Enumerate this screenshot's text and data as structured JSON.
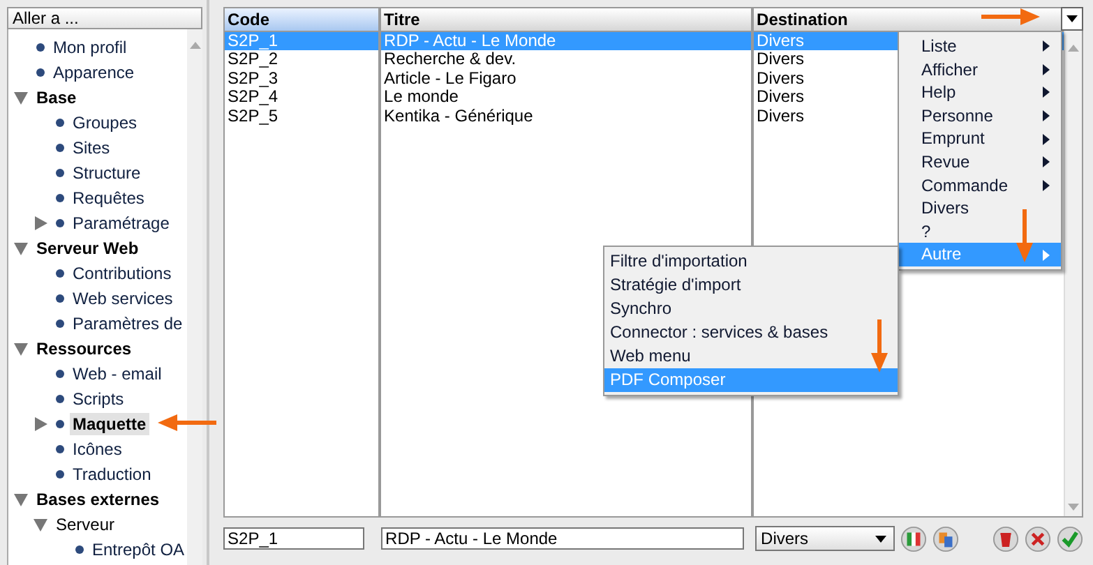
{
  "navigator": {
    "title": "Aller a ...",
    "tree": [
      {
        "label": "Mon profil",
        "kind": "item",
        "selected": false
      },
      {
        "label": "Apparence",
        "kind": "item",
        "selected": false
      },
      {
        "label": "Base",
        "kind": "section",
        "expanded": true,
        "selected": false,
        "children": [
          {
            "label": "Groupes",
            "kind": "item",
            "selected": false
          },
          {
            "label": "Sites",
            "kind": "item",
            "selected": false
          },
          {
            "label": "Structure",
            "kind": "item",
            "selected": false
          },
          {
            "label": "Requêtes",
            "kind": "item",
            "selected": false
          },
          {
            "label": "Paramétrage",
            "kind": "item",
            "expanded": false,
            "selected": false
          }
        ]
      },
      {
        "label": "Serveur Web",
        "kind": "section",
        "expanded": true,
        "selected": false,
        "children": [
          {
            "label": "Contributions",
            "kind": "item",
            "selected": false
          },
          {
            "label": "Web services",
            "kind": "item",
            "selected": false
          },
          {
            "label": "Paramètres de",
            "kind": "item",
            "selected": false
          }
        ]
      },
      {
        "label": "Ressources",
        "kind": "section",
        "expanded": true,
        "selected": false,
        "children": [
          {
            "label": "Web - email",
            "kind": "item",
            "selected": false
          },
          {
            "label": "Scripts",
            "kind": "item",
            "selected": false
          },
          {
            "label": "Maquette",
            "kind": "item",
            "expanded": false,
            "selected": true
          },
          {
            "label": "Icônes",
            "kind": "item",
            "selected": false
          },
          {
            "label": "Traduction",
            "kind": "item",
            "selected": false
          }
        ]
      },
      {
        "label": "Bases externes",
        "kind": "section",
        "expanded": true,
        "selected": false,
        "children": [
          {
            "label": "Serveur",
            "kind": "folder",
            "expanded": true,
            "selected": false,
            "children": [
              {
                "label": "Entrepôt OA",
                "kind": "item",
                "selected": false
              }
            ]
          }
        ]
      }
    ]
  },
  "table": {
    "columns": [
      "Code",
      "Titre",
      "Destination"
    ],
    "rows": [
      {
        "cells": [
          "S2P_1",
          "RDP - Actu - Le Monde",
          "Divers"
        ],
        "selected": true
      },
      {
        "cells": [
          "S2P_2",
          "Recherche & dev.",
          "Divers"
        ],
        "selected": false
      },
      {
        "cells": [
          "S2P_3",
          "Article - Le Figaro",
          "Divers"
        ],
        "selected": false
      },
      {
        "cells": [
          "S2P_4",
          "Le monde",
          "Divers"
        ],
        "selected": false
      },
      {
        "cells": [
          "S2P_5",
          "Kentika - Générique",
          "Divers"
        ],
        "selected": false
      }
    ]
  },
  "menu": [
    {
      "label": "Liste",
      "submenu": true,
      "selected": false
    },
    {
      "label": "Afficher",
      "submenu": true,
      "selected": false
    },
    {
      "label": "Help",
      "submenu": true,
      "selected": false
    },
    {
      "label": "Personne",
      "submenu": true,
      "selected": false
    },
    {
      "label": "Emprunt",
      "submenu": true,
      "selected": false
    },
    {
      "label": "Revue",
      "submenu": true,
      "selected": false
    },
    {
      "label": "Commande",
      "submenu": true,
      "selected": false
    },
    {
      "label": "Divers",
      "submenu": false,
      "selected": false
    },
    {
      "label": "?",
      "submenu": false,
      "selected": false
    },
    {
      "label": "Autre",
      "submenu": true,
      "selected": true
    }
  ],
  "submenu": [
    {
      "label": "Filtre d'importation",
      "selected": false
    },
    {
      "label": "Stratégie d'import",
      "selected": false
    },
    {
      "label": "Synchro",
      "selected": false
    },
    {
      "label": "Connector : services & bases",
      "selected": false
    },
    {
      "label": "Web menu",
      "selected": false
    },
    {
      "label": "PDF Composer",
      "selected": true
    }
  ],
  "editor": {
    "code": "S2P_1",
    "title": "RDP - Actu - Le Monde",
    "destination": "Divers"
  }
}
